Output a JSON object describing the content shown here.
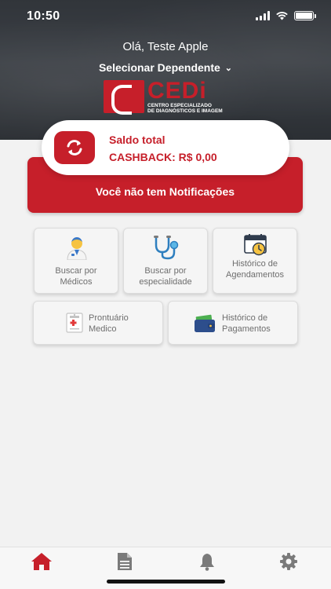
{
  "status": {
    "time": "10:50"
  },
  "header": {
    "greeting": "Olá, Teste Apple",
    "dependent_selector": "Selecionar Dependente",
    "logo_word": "CEDi",
    "logo_sub_line1": "CENTRO ESPECIALIZADO",
    "logo_sub_line2": "DE DIAGNÓSTICOS E IMAGEM"
  },
  "balance": {
    "title": "Saldo total",
    "cashback": "CASHBACK: R$ 0,00"
  },
  "notifications": {
    "message": "Você não tem Notificações"
  },
  "menu": [
    {
      "line1": "Buscar por",
      "line2": "Médicos",
      "icon": "doctor-icon"
    },
    {
      "line1": "Buscar por",
      "line2": "especialidade",
      "icon": "stethoscope-icon"
    },
    {
      "line1": "Histórico de",
      "line2": "Agendamentos",
      "icon": "calendar-clock-icon"
    },
    {
      "line1": "Prontuário",
      "line2": "Medico",
      "icon": "medical-record-icon"
    },
    {
      "line1": "Histórico de",
      "line2": "Pagamentos",
      "icon": "wallet-icon"
    }
  ],
  "tabbar": {
    "items": [
      "home-icon",
      "document-icon",
      "bell-icon",
      "settings-icon"
    ],
    "active": "home-icon"
  },
  "colors": {
    "brand_red": "#c61f2a",
    "tab_inactive": "#7a7a7a"
  }
}
